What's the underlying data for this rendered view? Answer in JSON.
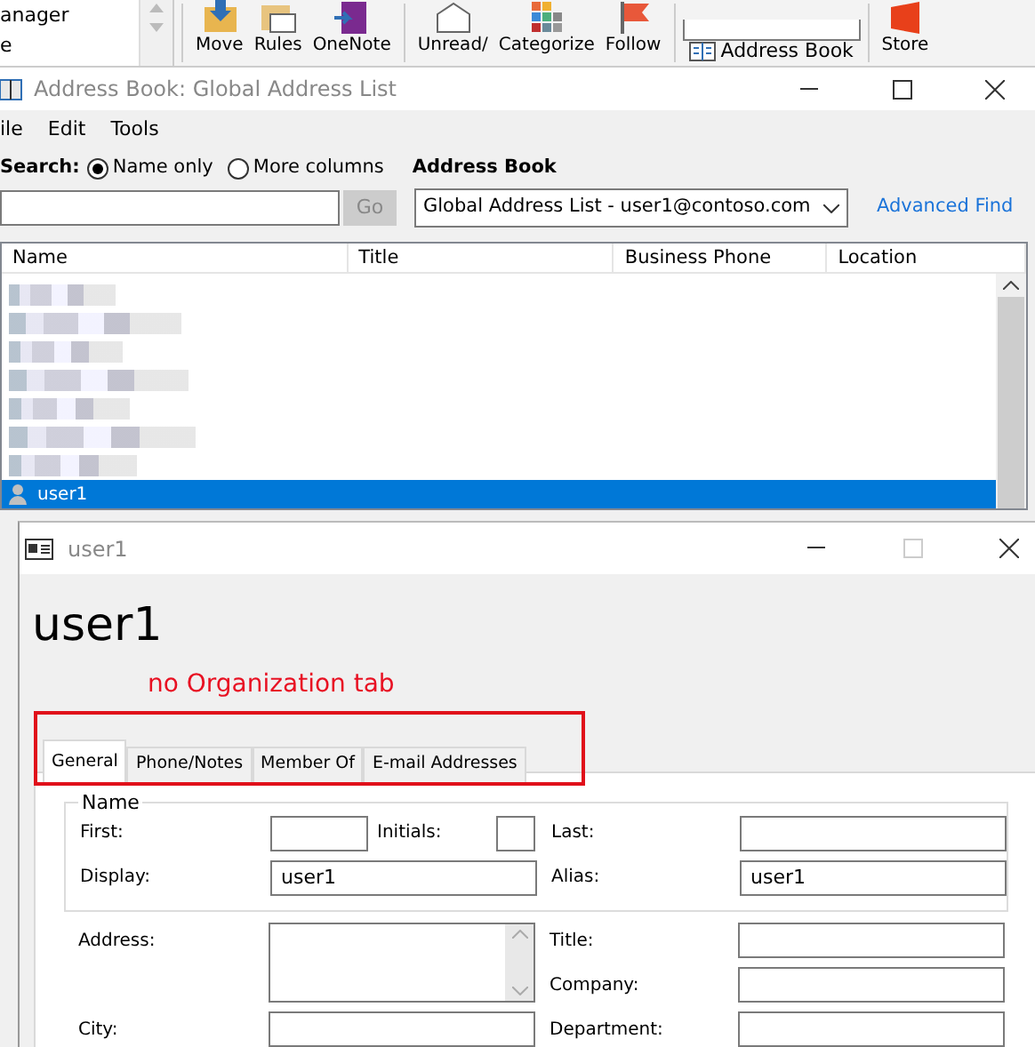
{
  "outlook_ribbon": {
    "folder_pane": [
      "anager",
      "e"
    ],
    "buttons": [
      {
        "label": "Move",
        "kind": "move"
      },
      {
        "label": "Rules",
        "kind": "rules"
      },
      {
        "label": "OneNote",
        "kind": "onenote"
      },
      {
        "label": "Unread/",
        "kind": "unread"
      },
      {
        "label": "Categorize",
        "kind": "categorize"
      },
      {
        "label": "Follow",
        "kind": "follow"
      }
    ],
    "address_book_button": "Address Book",
    "store_button": "Store"
  },
  "address_book_window": {
    "title": "Address Book: Global Address List",
    "menu": [
      "ile",
      "Edit",
      "Tools"
    ],
    "search_label": "Search:",
    "search_options": [
      {
        "label": "Name only",
        "selected": true
      },
      {
        "label": "More columns",
        "selected": false
      }
    ],
    "address_book_label": "Address Book",
    "go_button": {
      "label": "Go",
      "disabled": true
    },
    "address_book_select": "Global Address List - user1@contoso.com",
    "advanced_find": "Advanced Find",
    "columns": [
      "Name",
      "Title",
      "Business Phone",
      "Location"
    ],
    "rows": [
      {
        "kind": "redacted",
        "selected": false
      },
      {
        "kind": "redacted",
        "selected": false
      },
      {
        "kind": "redacted",
        "selected": false
      },
      {
        "kind": "redacted",
        "selected": false
      },
      {
        "kind": "redacted",
        "selected": false
      },
      {
        "kind": "redacted",
        "selected": false
      },
      {
        "kind": "redacted",
        "selected": false
      },
      {
        "kind": "user",
        "name": "user1",
        "selected": true
      }
    ]
  },
  "properties_dialog": {
    "title": "user1",
    "heading": "user1",
    "annotation": "no Organization tab",
    "tabs": [
      {
        "label": "General",
        "selected": true
      },
      {
        "label": "Phone/Notes",
        "selected": false
      },
      {
        "label": "Member Of",
        "selected": false
      },
      {
        "label": "E-mail Addresses",
        "selected": false
      }
    ],
    "name_group": {
      "legend": "Name",
      "rows": [
        {
          "left": [
            {
              "label": "First:",
              "kind": "short"
            },
            {
              "label": "Initials:",
              "kind": "tiny"
            }
          ],
          "right": {
            "label": "Last:"
          }
        },
        {
          "left": [
            {
              "label": "Display:",
              "kind": "full",
              "value": "user1"
            }
          ],
          "right": {
            "label": "Alias:",
            "value": "user1"
          }
        }
      ]
    },
    "left_fields": [
      {
        "label": "Address:",
        "kind": "multiline"
      },
      {
        "label": "City:",
        "kind": "full"
      }
    ],
    "right_fields": [
      {
        "label": "Title:"
      },
      {
        "label": "Company:"
      },
      {
        "label": "Department:"
      }
    ]
  }
}
